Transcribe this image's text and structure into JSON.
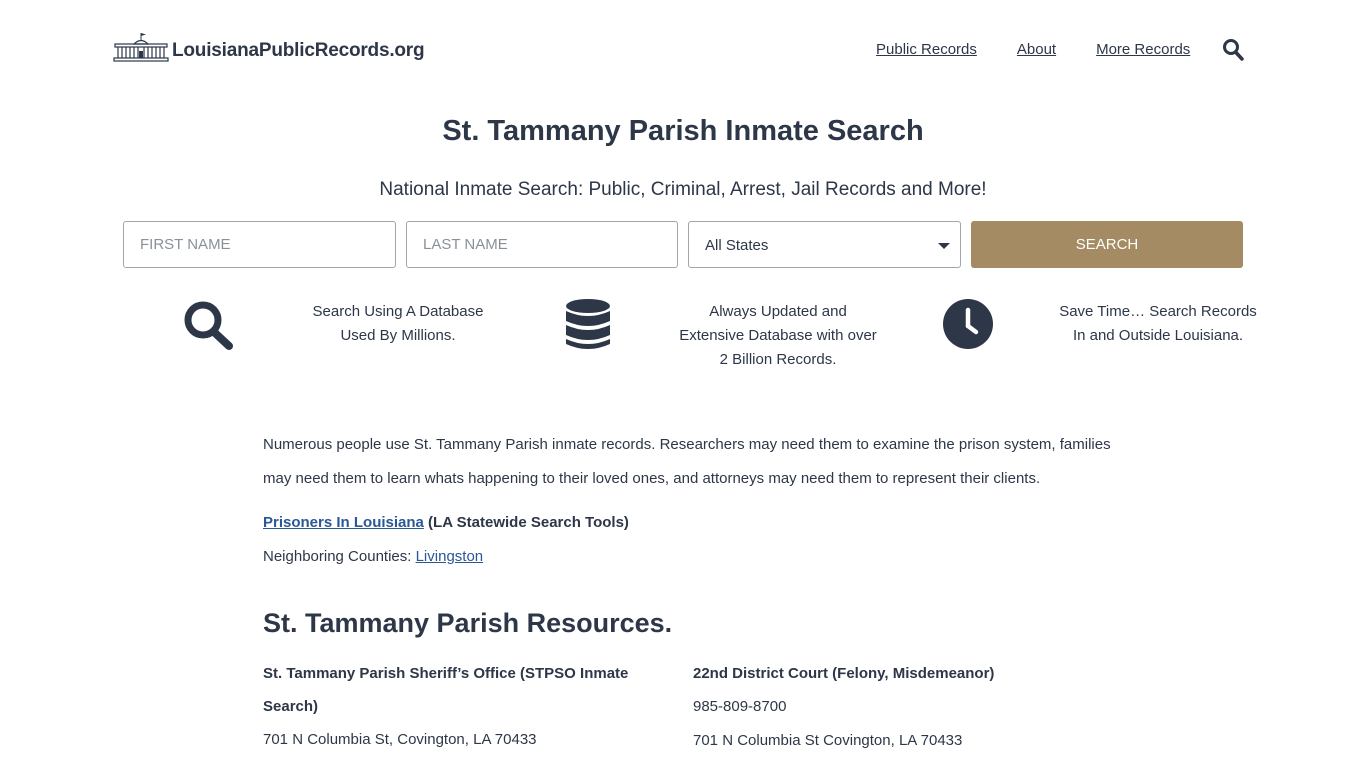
{
  "header": {
    "logo_text": "LouisianaPublicRecords.org",
    "logo_icon": "courthouse-icon",
    "nav": [
      {
        "label": "Public Records"
      },
      {
        "label": "About"
      },
      {
        "label": "More Records"
      }
    ],
    "search_icon": "search-icon"
  },
  "page": {
    "title": "St. Tammany Parish Inmate Search",
    "subtitle": "National Inmate Search: Public, Criminal, Arrest, Jail Records and More!"
  },
  "form": {
    "first_name_placeholder": "FIRST NAME",
    "last_name_placeholder": "LAST NAME",
    "state_selected": "All States",
    "search_label": "SEARCH"
  },
  "features": [
    {
      "icon": "magnifier-icon",
      "text": "Search Using A Database Used By Millions."
    },
    {
      "icon": "database-icon",
      "text": "Always Updated and Extensive Database with over 2 Billion Records."
    },
    {
      "icon": "clock-icon",
      "text": "Save Time… Search Records In and Outside Louisiana."
    }
  ],
  "content": {
    "intro": "Numerous people use St. Tammany Parish inmate records. Researchers may need them to examine the prison system, families may need them to learn whats happening to their loved ones, and attorneys may need them to represent their clients.",
    "prisoners_link": "Prisoners In Louisiana",
    "prisoners_suffix": " (LA Statewide Search Tools)",
    "neighbors_label": "Neighboring Counties: ",
    "neighbors_link": "Livingston",
    "resources_title": "St. Tammany Parish Resources."
  },
  "resources": [
    {
      "title": "St. Tammany Parish Sheriff’s Office (STPSO Inmate Search)",
      "lines": [
        "701 N Columbia St, Covington, LA 70433"
      ]
    },
    {
      "title": "22nd District Court (Felony, Misdemeanor)",
      "lines": [
        "985-809-8700",
        "701 N Columbia St Covington, LA 70433"
      ]
    }
  ],
  "colors": {
    "text": "#2d3748",
    "accent": "#a58b63",
    "link": "#2b5797"
  }
}
